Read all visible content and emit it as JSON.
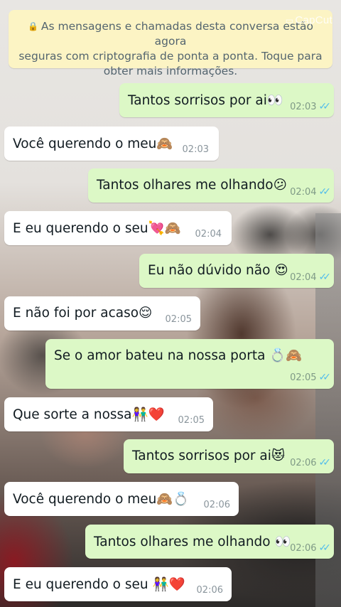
{
  "banner": {
    "lock_icon": "lock-icon",
    "line1": "As mensagens e chamadas desta conversa estão agora",
    "line2": "seguras com criptografia de ponta a ponta. Toque para",
    "line3": "obter mais informações."
  },
  "watermark": "CapCut",
  "messages": [
    {
      "direction": "out",
      "text": "Tantos sorrisos por ai👀",
      "time": "02:03",
      "read": true
    },
    {
      "direction": "in",
      "text": "Você querendo o meu🙈",
      "time": "02:03"
    },
    {
      "direction": "out",
      "text": "Tantos olhares me olhando😕",
      "time": "02:04",
      "read": true
    },
    {
      "direction": "in",
      "text": "E eu querendo o seu💘🙈",
      "time": "02:04"
    },
    {
      "direction": "out",
      "text": "Eu não dúvido não 😍",
      "time": "02:04",
      "read": true
    },
    {
      "direction": "in",
      "text": "E não foi por acaso😌",
      "time": "02:05"
    },
    {
      "direction": "out",
      "text": "Se o amor bateu na nossa porta 💍🙈",
      "time": "02:05",
      "read": true
    },
    {
      "direction": "in",
      "text": "Que sorte a nossa👫❤️",
      "time": "02:05"
    },
    {
      "direction": "out",
      "text": "Tantos sorrisos por ai😻",
      "time": "02:06",
      "read": true
    },
    {
      "direction": "in",
      "text": "Você querendo o meu🙈💍",
      "time": "02:06"
    },
    {
      "direction": "out",
      "text": "Tantos olhares me olhando 👀",
      "time": "02:06",
      "read": true
    },
    {
      "direction": "in",
      "text": "E eu querendo o seu 👫❤️",
      "time": "02:06"
    }
  ],
  "colors": {
    "outgoing_bubble": "#dcf8c6",
    "incoming_bubble": "#ffffff",
    "banner": "#fcf4c4",
    "read_ticks": "#53bdeb"
  }
}
